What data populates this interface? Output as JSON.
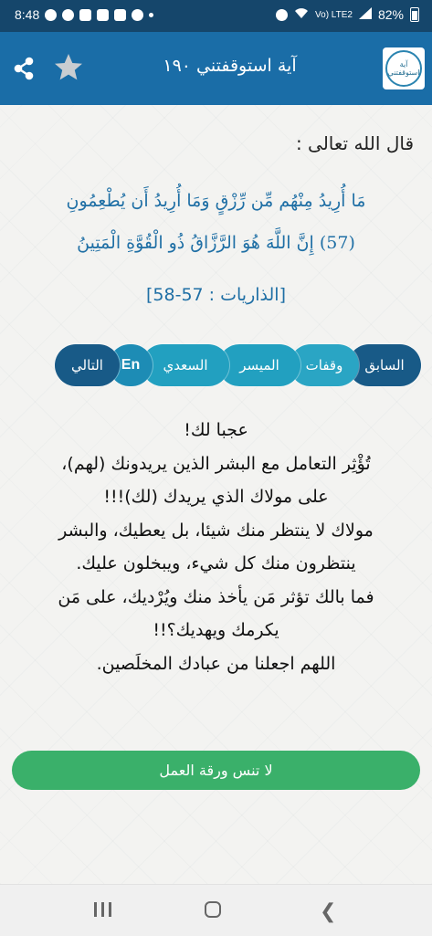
{
  "status_bar": {
    "time": "8:48",
    "network": "Vo) LTE2",
    "battery": "82%"
  },
  "app_bar": {
    "title": "آية استوقفتني ١٩٠",
    "logo_text": "آية استوقفتني"
  },
  "content": {
    "intro": "قال الله تعالى :",
    "verse_line1": "مَا أُرِيدُ مِنْهُم مِّن رِّزْقٍ وَمَا أُرِيدُ أَن يُطْعِمُونِ",
    "verse_line2": "(57) إِنَّ اللَّهَ هُوَ الرَّزَّاقُ ذُو الْقُوَّةِ الْمَتِينُ",
    "reference": "[الذاريات : 57-58]",
    "tabs": {
      "previous": "السابق",
      "waqafat": "وقفات",
      "muyassar": "الميسر",
      "saadi": "السعدي",
      "english": "En",
      "next": "التالي"
    },
    "body_lines": [
      "عجبا لك!",
      "تُؤْثِر التعامل مع البشر الذين يريدونك (لهم)،",
      "على مولاك الذي يريدك (لك)!!!",
      "مولاك لا ينتظر منك شيئا، بل يعطيك، والبشر",
      "ينتظرون منك كل شيء، ويبخلون عليك.",
      "فما بالك تؤثر مَن يأخذ منك ويُرْديك، على مَن",
      "يكرمك ويهديك؟!!",
      "اللهم اجعلنا من عبادك المخلَصين."
    ],
    "worksheet_button": "لا تنس ورقة العمل"
  },
  "colors": {
    "status_bar": "#15466b",
    "app_bar": "#1a6da7",
    "verse_text": "#1f6fa5",
    "tab_dark": "#185a87",
    "tab_light": "#22a0c0",
    "worksheet_button": "#3ab06a"
  },
  "icons": [
    "share-icon",
    "star-icon",
    "app-logo",
    "recent-apps-icon",
    "home-icon",
    "back-icon"
  ]
}
